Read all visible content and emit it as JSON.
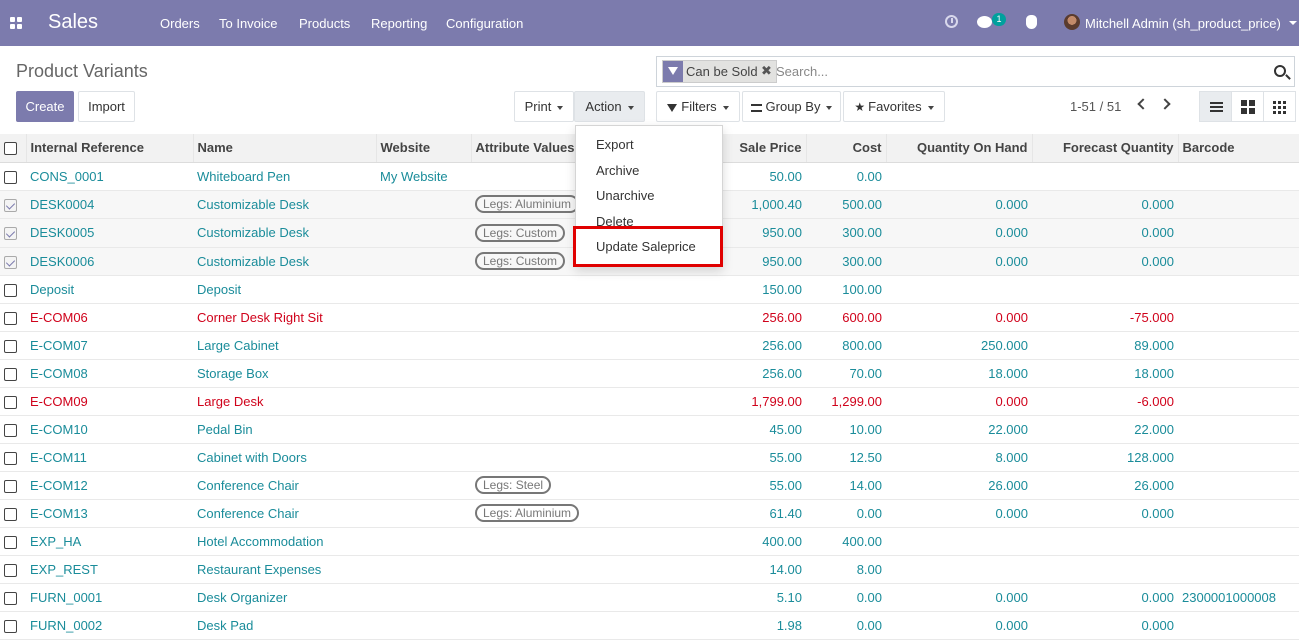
{
  "navbar": {
    "brand": "Sales",
    "menu": [
      "Orders",
      "To Invoice",
      "Products",
      "Reporting",
      "Configuration"
    ],
    "chat_badge": "1",
    "user": "Mitchell Admin (sh_product_price)"
  },
  "page": {
    "title": "Product Variants"
  },
  "buttons": {
    "create": "Create",
    "import": "Import",
    "print": "Print",
    "action": "Action",
    "filters": "Filters",
    "group_by": "Group By",
    "favorites": "Favorites"
  },
  "search": {
    "facet": "Can be Sold",
    "placeholder": "Search..."
  },
  "pager": {
    "text": "1-51 / 51"
  },
  "action_menu": {
    "items": [
      "Export",
      "Archive",
      "Unarchive",
      "Delete",
      "Update Saleprice"
    ]
  },
  "table": {
    "headers": [
      "Internal Reference",
      "Name",
      "Website",
      "Attribute Values",
      "Sale Price",
      "Cost",
      "Quantity On Hand",
      "Forecast Quantity",
      "Barcode"
    ],
    "rows": [
      {
        "ref": "CONS_0001",
        "name": "Whiteboard Pen",
        "website": "My Website",
        "attr": "",
        "price": "50.00",
        "cost": "0.00",
        "qty": "",
        "forecast": "",
        "barcode": ""
      },
      {
        "ref": "DESK0004",
        "name": "Customizable Desk",
        "website": "",
        "attr": "Legs: Aluminium",
        "price": "1,000.40",
        "cost": "500.00",
        "qty": "0.000",
        "forecast": "0.000",
        "barcode": ""
      },
      {
        "ref": "DESK0005",
        "name": "Customizable Desk",
        "website": "",
        "attr": "Legs: Custom",
        "price": "950.00",
        "cost": "300.00",
        "qty": "0.000",
        "forecast": "0.000",
        "barcode": ""
      },
      {
        "ref": "DESK0006",
        "name": "Customizable Desk",
        "website": "",
        "attr": "Legs: Custom",
        "price": "950.00",
        "cost": "300.00",
        "qty": "0.000",
        "forecast": "0.000",
        "barcode": ""
      },
      {
        "ref": "Deposit",
        "name": "Deposit",
        "website": "",
        "attr": "",
        "price": "150.00",
        "cost": "100.00",
        "qty": "",
        "forecast": "",
        "barcode": ""
      },
      {
        "ref": "E-COM06",
        "name": "Corner Desk Right Sit",
        "website": "",
        "attr": "",
        "price": "256.00",
        "cost": "600.00",
        "qty": "0.000",
        "forecast": "-75.000",
        "barcode": ""
      },
      {
        "ref": "E-COM07",
        "name": "Large Cabinet",
        "website": "",
        "attr": "",
        "price": "256.00",
        "cost": "800.00",
        "qty": "250.000",
        "forecast": "89.000",
        "barcode": ""
      },
      {
        "ref": "E-COM08",
        "name": "Storage Box",
        "website": "",
        "attr": "",
        "price": "256.00",
        "cost": "70.00",
        "qty": "18.000",
        "forecast": "18.000",
        "barcode": ""
      },
      {
        "ref": "E-COM09",
        "name": "Large Desk",
        "website": "",
        "attr": "",
        "price": "1,799.00",
        "cost": "1,299.00",
        "qty": "0.000",
        "forecast": "-6.000",
        "barcode": ""
      },
      {
        "ref": "E-COM10",
        "name": "Pedal Bin",
        "website": "",
        "attr": "",
        "price": "45.00",
        "cost": "10.00",
        "qty": "22.000",
        "forecast": "22.000",
        "barcode": ""
      },
      {
        "ref": "E-COM11",
        "name": "Cabinet with Doors",
        "website": "",
        "attr": "",
        "price": "55.00",
        "cost": "12.50",
        "qty": "8.000",
        "forecast": "128.000",
        "barcode": ""
      },
      {
        "ref": "E-COM12",
        "name": "Conference Chair",
        "website": "",
        "attr": "Legs: Steel",
        "price": "55.00",
        "cost": "14.00",
        "qty": "26.000",
        "forecast": "26.000",
        "barcode": ""
      },
      {
        "ref": "E-COM13",
        "name": "Conference Chair",
        "website": "",
        "attr": "Legs: Aluminium",
        "price": "61.40",
        "cost": "0.00",
        "qty": "0.000",
        "forecast": "0.000",
        "barcode": ""
      },
      {
        "ref": "EXP_HA",
        "name": "Hotel Accommodation",
        "website": "",
        "attr": "",
        "price": "400.00",
        "cost": "400.00",
        "qty": "",
        "forecast": "",
        "barcode": ""
      },
      {
        "ref": "EXP_REST",
        "name": "Restaurant Expenses",
        "website": "",
        "attr": "",
        "price": "14.00",
        "cost": "8.00",
        "qty": "",
        "forecast": "",
        "barcode": ""
      },
      {
        "ref": "FURN_0001",
        "name": "Desk Organizer",
        "website": "",
        "attr": "",
        "price": "5.10",
        "cost": "0.00",
        "qty": "0.000",
        "forecast": "0.000",
        "barcode": "2300001000008"
      },
      {
        "ref": "FURN_0002",
        "name": "Desk Pad",
        "website": "",
        "attr": "",
        "price": "1.98",
        "cost": "0.00",
        "qty": "0.000",
        "forecast": "0.000",
        "barcode": ""
      }
    ]
  }
}
